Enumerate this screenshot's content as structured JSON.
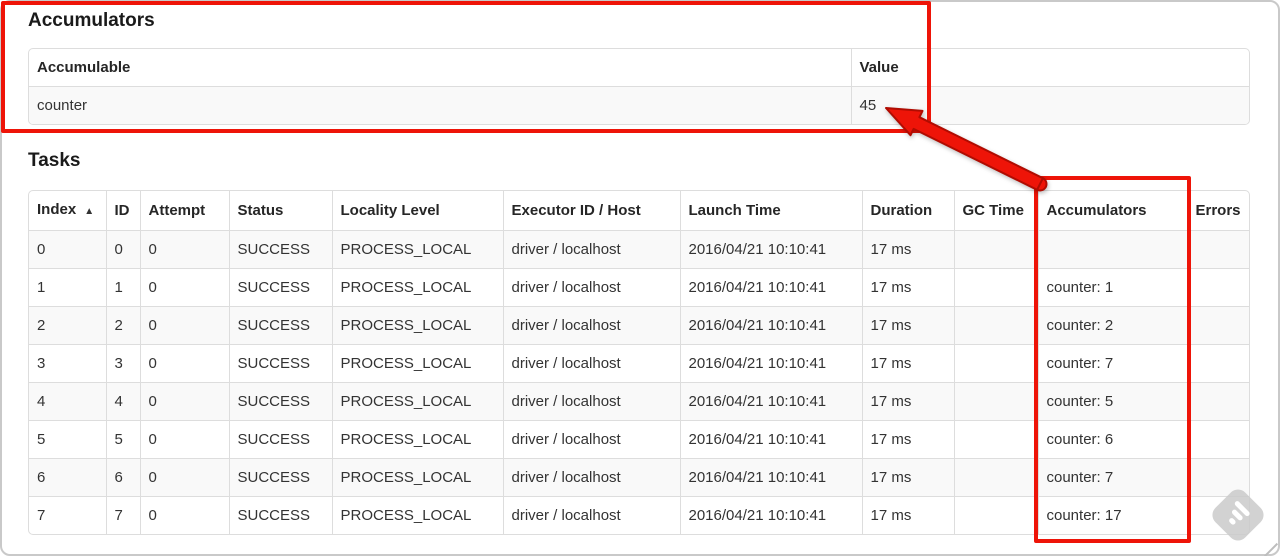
{
  "accumulators_section": {
    "title": "Accumulators",
    "table": {
      "headers": {
        "accumulable": "Accumulable",
        "value": "Value"
      },
      "rows": [
        {
          "accumulable": "counter",
          "value": "45"
        }
      ]
    }
  },
  "tasks_section": {
    "title": "Tasks",
    "table": {
      "headers": [
        "Index",
        "ID",
        "Attempt",
        "Status",
        "Locality Level",
        "Executor ID / Host",
        "Launch Time",
        "Duration",
        "GC Time",
        "Accumulators",
        "Errors"
      ],
      "sort_icon": "▲",
      "rows": [
        [
          "0",
          "0",
          "0",
          "SUCCESS",
          "PROCESS_LOCAL",
          "driver / localhost",
          "2016/04/21 10:10:41",
          "17 ms",
          "",
          "",
          ""
        ],
        [
          "1",
          "1",
          "0",
          "SUCCESS",
          "PROCESS_LOCAL",
          "driver / localhost",
          "2016/04/21 10:10:41",
          "17 ms",
          "",
          "counter: 1",
          ""
        ],
        [
          "2",
          "2",
          "0",
          "SUCCESS",
          "PROCESS_LOCAL",
          "driver / localhost",
          "2016/04/21 10:10:41",
          "17 ms",
          "",
          "counter: 2",
          ""
        ],
        [
          "3",
          "3",
          "0",
          "SUCCESS",
          "PROCESS_LOCAL",
          "driver / localhost",
          "2016/04/21 10:10:41",
          "17 ms",
          "",
          "counter: 7",
          ""
        ],
        [
          "4",
          "4",
          "0",
          "SUCCESS",
          "PROCESS_LOCAL",
          "driver / localhost",
          "2016/04/21 10:10:41",
          "17 ms",
          "",
          "counter: 5",
          ""
        ],
        [
          "5",
          "5",
          "0",
          "SUCCESS",
          "PROCESS_LOCAL",
          "driver / localhost",
          "2016/04/21 10:10:41",
          "17 ms",
          "",
          "counter: 6",
          ""
        ],
        [
          "6",
          "6",
          "0",
          "SUCCESS",
          "PROCESS_LOCAL",
          "driver / localhost",
          "2016/04/21 10:10:41",
          "17 ms",
          "",
          "counter: 7",
          ""
        ],
        [
          "7",
          "7",
          "0",
          "SUCCESS",
          "PROCESS_LOCAL",
          "driver / localhost",
          "2016/04/21 10:10:41",
          "17 ms",
          "",
          "counter: 17",
          ""
        ]
      ]
    }
  },
  "annotations": {
    "highlight_color": "#ee1408"
  }
}
